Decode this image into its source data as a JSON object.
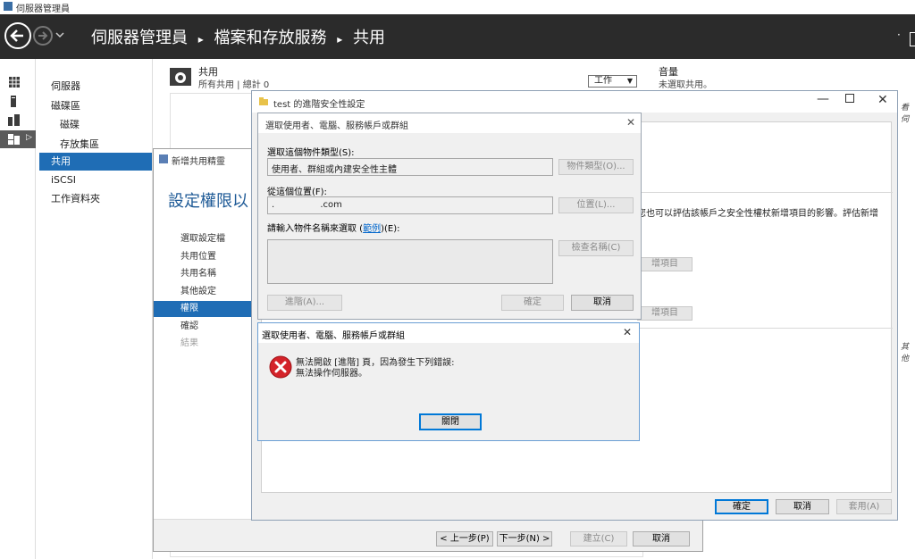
{
  "app": {
    "window_title": "伺服器管理員",
    "breadcrumb": [
      "伺服器管理員",
      "檔案和存放服務",
      "共用"
    ]
  },
  "sidebar": {
    "items": [
      {
        "label": "伺服器",
        "indent": false
      },
      {
        "label": "磁碟區",
        "indent": false
      },
      {
        "label": "磁碟",
        "indent": true
      },
      {
        "label": "存放集區",
        "indent": true
      },
      {
        "label": "共用",
        "indent": false,
        "selected": true
      },
      {
        "label": "iSCSI",
        "indent": false
      },
      {
        "label": "工作資料夾",
        "indent": false
      }
    ]
  },
  "shares": {
    "title": "共用",
    "subtitle": "所有共用 | 總計 0",
    "tasks_label": "工作",
    "volume_title": "音量",
    "volume_subtitle": "未選取共用。"
  },
  "wizard": {
    "title": "新增共用精靈",
    "heading": "設定權限以",
    "steps": [
      "選取設定檔",
      "共用位置",
      "共用名稱",
      "其他設定",
      "權限",
      "確認",
      "結果"
    ],
    "active_step": 4,
    "buttons": {
      "prev": "< 上一步(P)",
      "next": "下一步(N) >",
      "create": "建立(C)",
      "cancel": "取消"
    }
  },
  "security": {
    "title": "test 的進階安全性設定",
    "text_partial": "您也可以評估該帳戶之安全性權杖新增項目的影響。評估新增",
    "add_item_label": "增項目",
    "right_partial_1": "看伺",
    "right_partial_2": "其他",
    "buttons": {
      "ok": "確定",
      "cancel": "取消",
      "apply": "套用(A)"
    }
  },
  "select_dialog": {
    "title": "選取使用者、電腦、服務帳戶或群組",
    "object_type_label": "選取這個物件類型(S):",
    "object_type_value": "使用者、群組或內建安全性主體",
    "object_type_button": "物件類型(O)...",
    "location_label": "從這個位置(F):",
    "location_value_prefix": ".",
    "location_value_suffix": ".com",
    "location_button": "位置(L)...",
    "names_label_prefix": "請輸入物件名稱來選取 (",
    "names_label_link": "範例",
    "names_label_suffix": ")(E):",
    "check_names_button": "檢查名稱(C)",
    "advanced_button": "進階(A)...",
    "ok_button": "確定",
    "cancel_button": "取消"
  },
  "error_dialog": {
    "title": "選取使用者、電腦、服務帳戶或群組",
    "message_line1": "無法開啟 [進階] 頁，因為發生下列錯誤:",
    "message_line2": "無法操作伺服器。",
    "close_button": "關閉"
  },
  "colors": {
    "titlebar": "#2b2b2b",
    "accent": "#0078d7",
    "error_red": "#d4232a"
  }
}
